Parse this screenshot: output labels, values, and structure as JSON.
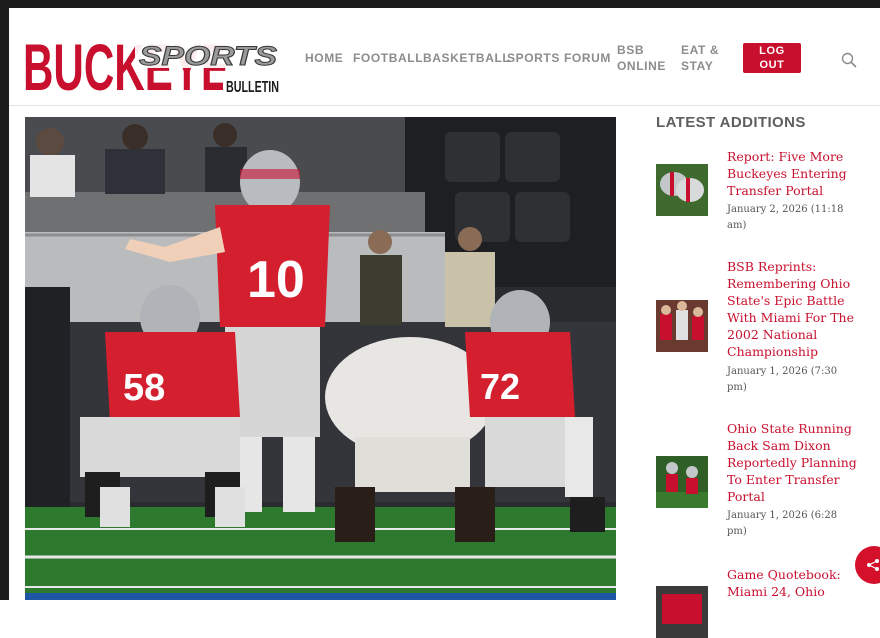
{
  "brand": {
    "name_main": "BUCKEYE",
    "name_overlay": "SPORTS",
    "name_sub": "BULLETIN",
    "red": "#c8102e"
  },
  "nav": {
    "items": [
      "HOME",
      "FOOTBALL",
      "BASKETBALL",
      "SPORTS",
      "FORUM"
    ],
    "bsb_online": [
      "BSB",
      "ONLINE"
    ],
    "eat_stay": [
      "EAT &",
      "STAY"
    ],
    "logout": [
      "LOG",
      "OUT"
    ],
    "search_icon": "search-icon"
  },
  "sidebar": {
    "title": "LATEST ADDITIONS",
    "articles": [
      {
        "title": "Report: Five More Buckeyes Entering Transfer Portal",
        "date": "January 2, 2026 (11:18 am)"
      },
      {
        "title": "BSB Reprints: Remembering Ohio State's Epic Battle With Miami For The 2002 National Championship",
        "date": "January 1, 2026 (7:30 pm)"
      },
      {
        "title": "Ohio State Running Back Sam Dixon Reportedly Planning To Enter Transfer Portal",
        "date": "January 1, 2026 (6:28 pm)"
      },
      {
        "title": "Game Quotebook: Miami 24, Ohio",
        "date": ""
      }
    ]
  },
  "share_icon": "share-icon"
}
